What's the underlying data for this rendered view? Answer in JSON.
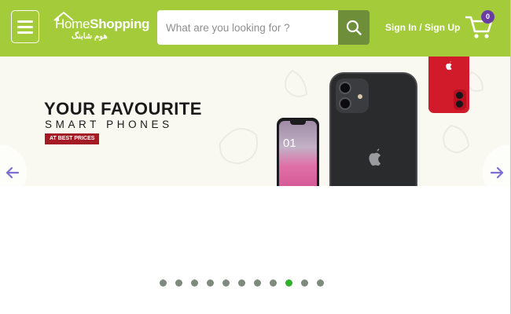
{
  "header": {
    "menu_icon": "hamburger-menu-icon",
    "logo": {
      "text_light": "Home",
      "text_bold": "Shopping",
      "subtext": "هوم شابنگ"
    },
    "search": {
      "placeholder": "What are you looking for ?",
      "value": "",
      "icon": "search-icon"
    },
    "signin_label": "Sign In / Sign Up",
    "cart": {
      "icon": "shopping-cart-icon",
      "count": "0"
    },
    "colors": {
      "bar": "#a4cb3a",
      "search_button": "#6e8e3a",
      "badge": "#6a3ea1"
    }
  },
  "banner": {
    "headline": "YOUR FAVOURITE",
    "subline": "SMART PHONES",
    "price_tag": "AT BEST PRICES",
    "phone_screen_time": "01",
    "prev_icon": "arrow-left-icon",
    "next_icon": "arrow-right-icon",
    "colors": {
      "background": "#f9f8f1",
      "tag": "#a41a25"
    }
  },
  "carousel": {
    "slide_count": 11,
    "active_index": 8,
    "colors": {
      "dot": "#7e8a7d",
      "active_dot": "#2fb12f"
    }
  }
}
